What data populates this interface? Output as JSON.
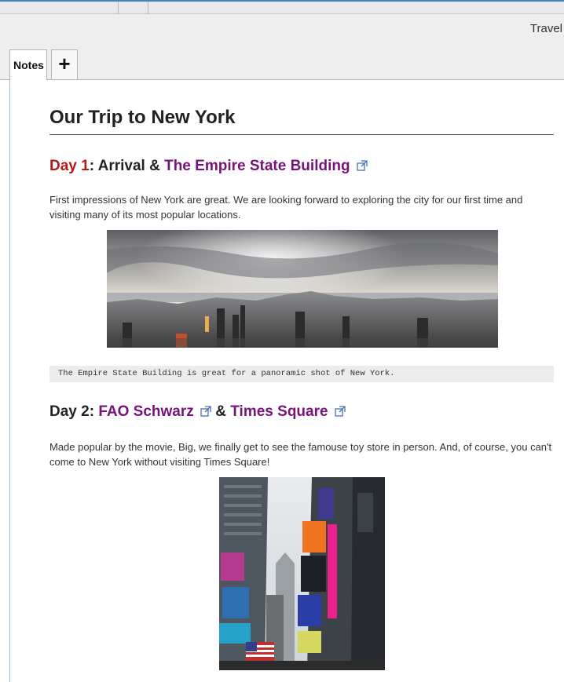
{
  "app": {
    "notebook_title": "Travel"
  },
  "tabs": {
    "active_label": "Notes",
    "add_symbol": "+"
  },
  "page": {
    "title": "Our Trip to New York",
    "day1": {
      "prefix": "Day 1",
      "colon_text": ": Arrival & ",
      "link1": "The Empire State Building",
      "paragraph": "First impressions of New York are great. We are looking forward to exploring the city for our first time and visiting many of its most popular locations.",
      "caption": "The Empire State Building is great for a panoramic shot of New York."
    },
    "day2": {
      "prefix": "Day 2: ",
      "link1": "FAO Schwarz",
      "amp": " & ",
      "link2": "Times Square",
      "paragraph": "Made popular by the movie, Big, we finally get to see the famouse toy store in person. And, of course, you can't come to New York without visiting Times Square!"
    }
  },
  "icons": {
    "external_link": "external-link-icon"
  },
  "colors": {
    "day_red": "#b51818",
    "link_purple": "#77127a",
    "tab_border": "#b5b5b5"
  }
}
